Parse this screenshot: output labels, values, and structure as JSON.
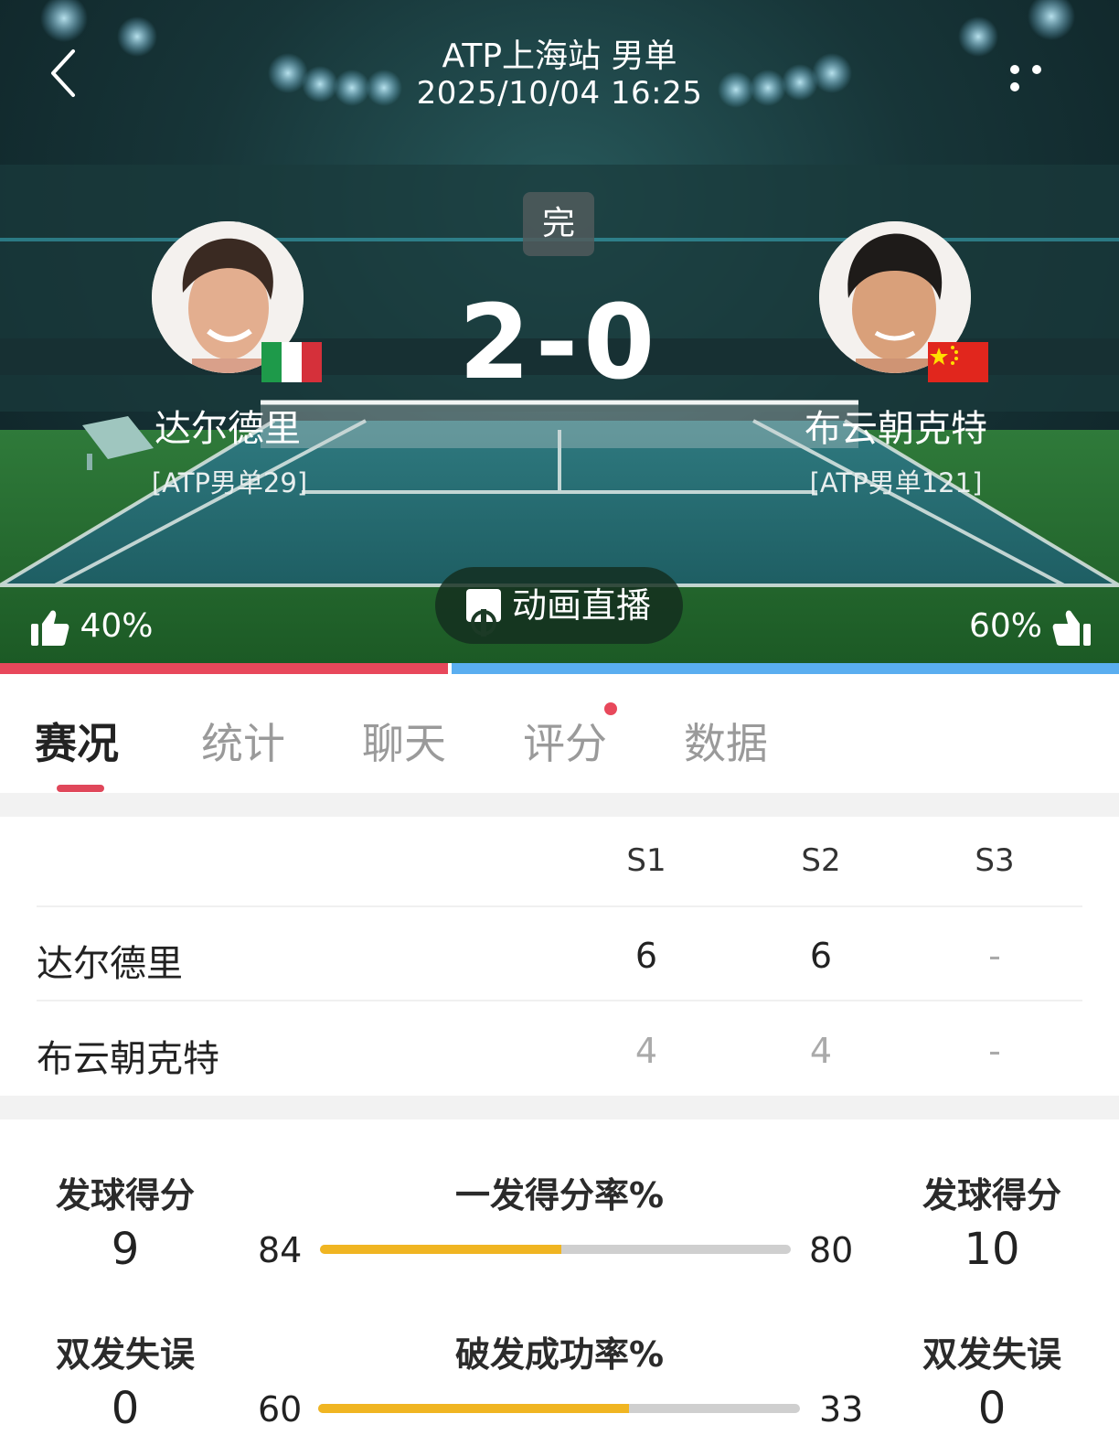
{
  "header": {
    "title": "ATP上海站 男单",
    "datetime": "2025/10/04 16:25"
  },
  "match": {
    "status": "完",
    "score": "2-0"
  },
  "players": {
    "home": {
      "name": "达尔德里",
      "rank": "[ATP男单29]",
      "flag": "Italy",
      "vote": "40%"
    },
    "away": {
      "name": "布云朝克特",
      "rank": "[ATP男单121]",
      "flag": "China",
      "vote": "60%"
    }
  },
  "live_button": "动画直播",
  "vote_split": {
    "home_fraction": 0.4,
    "away_fraction": 0.6,
    "home_color": "#e8485b",
    "away_color": "#5aaef0"
  },
  "tabs": [
    "赛况",
    "统计",
    "聊天",
    "评分",
    "数据"
  ],
  "sets": {
    "headers": [
      "S1",
      "S2",
      "S3"
    ],
    "rows": [
      {
        "name": "达尔德里",
        "scores": [
          "6",
          "6",
          "-"
        ]
      },
      {
        "name": "布云朝克特",
        "scores": [
          "4",
          "4",
          "-"
        ]
      }
    ]
  },
  "stats": [
    {
      "left_label": "发球得分",
      "left_value": "9",
      "title": "一发得分率%",
      "left_pct": "84",
      "right_pct": "80",
      "right_label": "发球得分",
      "right_value": "10",
      "bar_fraction": 0.513
    },
    {
      "left_label": "双发失误",
      "left_value": "0",
      "title": "破发成功率%",
      "left_pct": "60",
      "right_pct": "33",
      "right_label": "双发失误",
      "right_value": "0",
      "bar_fraction": 0.645
    }
  ],
  "colors": {
    "accent": "#e0475a",
    "bar_fill": "#f0b522",
    "bar_track": "#cfcfcf"
  }
}
